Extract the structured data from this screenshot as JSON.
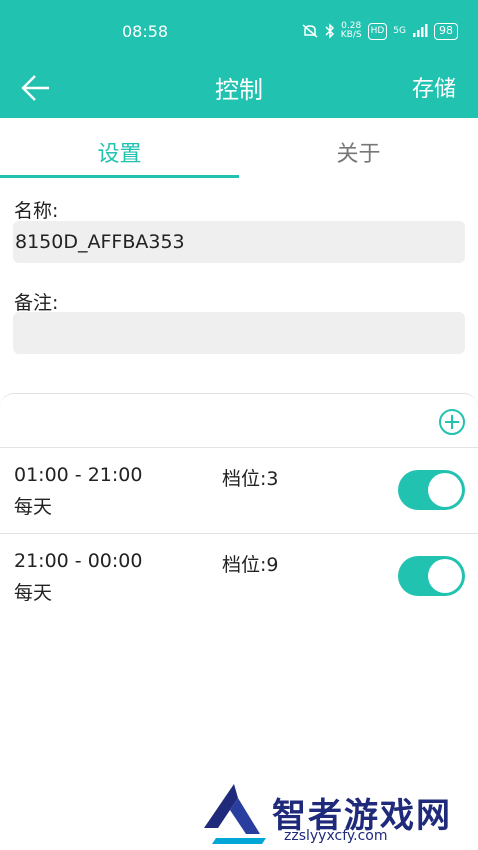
{
  "status_bar": {
    "time": "08:58",
    "net_speed_value": "0.28",
    "net_speed_unit": "KB/S",
    "hd": "HD",
    "signal": "5G",
    "battery": "98"
  },
  "app_bar": {
    "title": "控制",
    "save_label": "存储"
  },
  "tabs": [
    {
      "label": "设置",
      "active": true
    },
    {
      "label": "关于",
      "active": false
    }
  ],
  "form": {
    "name_label": "名称:",
    "name_value": "8150D_AFFBA353",
    "note_label": "备注:",
    "note_value": ""
  },
  "schedules": [
    {
      "time": "01:00 - 21:00",
      "repeat": "每天",
      "gear": "档位:3",
      "enabled": true
    },
    {
      "time": "21:00 - 00:00",
      "repeat": "每天",
      "gear": "档位:9",
      "enabled": true
    }
  ],
  "watermark": {
    "text": "智者游戏网",
    "url": "zzslyyxcfy.com"
  },
  "colors": {
    "accent": "#22c2b0",
    "field_bg": "#efefef",
    "divider": "#e3e3e3"
  }
}
